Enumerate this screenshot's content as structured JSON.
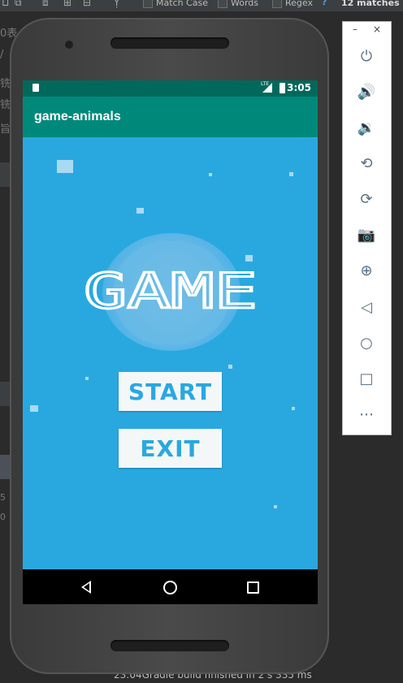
{
  "ide": {
    "options": [
      "Match Case",
      "Words",
      "Regex"
    ],
    "help": "?",
    "matches": "12 matches",
    "status": "23:04Gradle build finished in 2 s 335 ms",
    "left_fragments": [
      "0表",
      "/",
      "铣",
      "铣",
      "旨",
      "5",
      "0"
    ]
  },
  "phone": {
    "status_time": "3:05",
    "lte_label": "LTE",
    "app_title": "game-animals",
    "game_title": "GAME",
    "start_label": "START",
    "exit_label": "EXIT"
  },
  "toolbar": {
    "minimize": "–",
    "close": "×",
    "items": [
      "power-icon",
      "volume-up-icon",
      "volume-down-icon",
      "rotate-left-icon",
      "rotate-right-icon",
      "camera-icon",
      "zoom-icon",
      "back-icon",
      "home-icon",
      "overview-icon",
      "more-icon"
    ]
  },
  "colors": {
    "screen_bg": "#29a8e0",
    "app_bar": "#00897b",
    "status_bar": "#00695c",
    "button_bg": "#f4f7f8",
    "button_text": "#29a8e0"
  }
}
